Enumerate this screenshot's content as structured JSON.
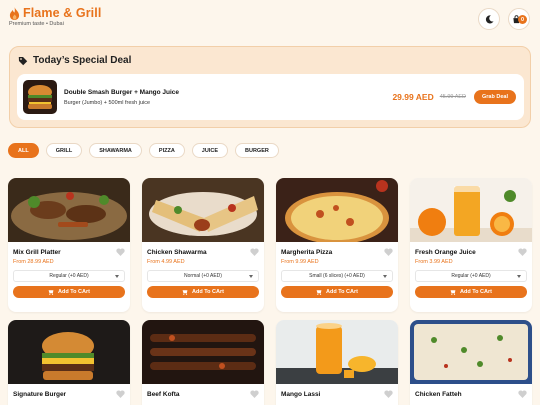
{
  "header": {
    "brand": "Flame & Grill",
    "tagline": "Premium taste • Dubai",
    "icons": [
      "flame-icon",
      "moon-icon",
      "cart-icon"
    ],
    "cart_count": "0"
  },
  "deal": {
    "title": "Today’s Special Deal",
    "name": "Double Smash Burger + Mango Juice",
    "description": "Burger (Jumbo) + 500ml fresh juice",
    "price": "29.99 AED",
    "old_price": "45.99 AED",
    "button": "Grab Deal"
  },
  "categories": [
    {
      "label": "ALL",
      "active": true
    },
    {
      "label": "GRILL",
      "active": false
    },
    {
      "label": "SHAWARMA",
      "active": false
    },
    {
      "label": "PIZZA",
      "active": false
    },
    {
      "label": "JUICE",
      "active": false
    },
    {
      "label": "BURGER",
      "active": false
    }
  ],
  "products": [
    {
      "name": "Mix Grill Platter",
      "price": "From 28.99 AED",
      "option": "Regular (+0 AED)",
      "button": "Add To CArt",
      "image": "mixed-grill"
    },
    {
      "name": "Chicken Shawarma",
      "price": "From 4.99 AED",
      "option": "Normal (+0 AED)",
      "button": "Add To CArt",
      "image": "shawarma"
    },
    {
      "name": "Margherita Pizza",
      "price": "From 9.99 AED",
      "option": "Small (6 slices) (+0 AED)",
      "button": "Add To CArt",
      "image": "pizza"
    },
    {
      "name": "Fresh Orange Juice",
      "price": "From 3.99 AED",
      "option": "Regular (+0 AED)",
      "button": "Add To CArt",
      "image": "orange-juice"
    },
    {
      "name": "Signature Burger",
      "image": "burger"
    },
    {
      "name": "Beef Kofta",
      "image": "kofta"
    },
    {
      "name": "Mango Lassi",
      "image": "mango-lassi"
    },
    {
      "name": "Chicken Fatteh",
      "image": "fatteh"
    }
  ],
  "colors": {
    "accent": "#e8731c",
    "background": "#fdf6ec",
    "deal_bg": "#fbe7d1"
  }
}
